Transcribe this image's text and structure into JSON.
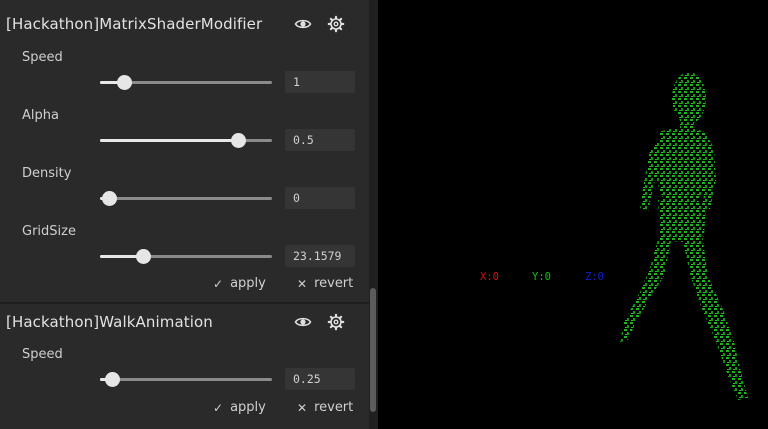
{
  "panel": {
    "sections": [
      {
        "title": "[Hackathon]MatrixShaderModifier",
        "params": [
          {
            "label": "Speed",
            "value": "1",
            "level": 0.14
          },
          {
            "label": "Alpha",
            "value": "0.5",
            "level": 0.8
          },
          {
            "label": "Density",
            "value": "0",
            "level": 0.05
          },
          {
            "label": "GridSize",
            "value": "23.1579",
            "level": 0.25
          }
        ],
        "apply_label": "apply",
        "revert_label": "revert"
      },
      {
        "title": "[Hackathon]WalkAnimation",
        "params": [
          {
            "label": "Speed",
            "value": "0.25",
            "level": 0.07
          }
        ],
        "apply_label": "apply",
        "revert_label": "revert"
      }
    ],
    "icons": [
      "eye-icon",
      "gear-icon",
      "check-icon",
      "cross-icon"
    ]
  },
  "viewport": {
    "axes": [
      {
        "text": "X:0",
        "color": "#d01010"
      },
      {
        "text": "Y:0",
        "color": "#10c010"
      },
      {
        "text": "Z:0",
        "color": "#1020d0"
      }
    ],
    "figure_color": "#1fbf1f"
  }
}
